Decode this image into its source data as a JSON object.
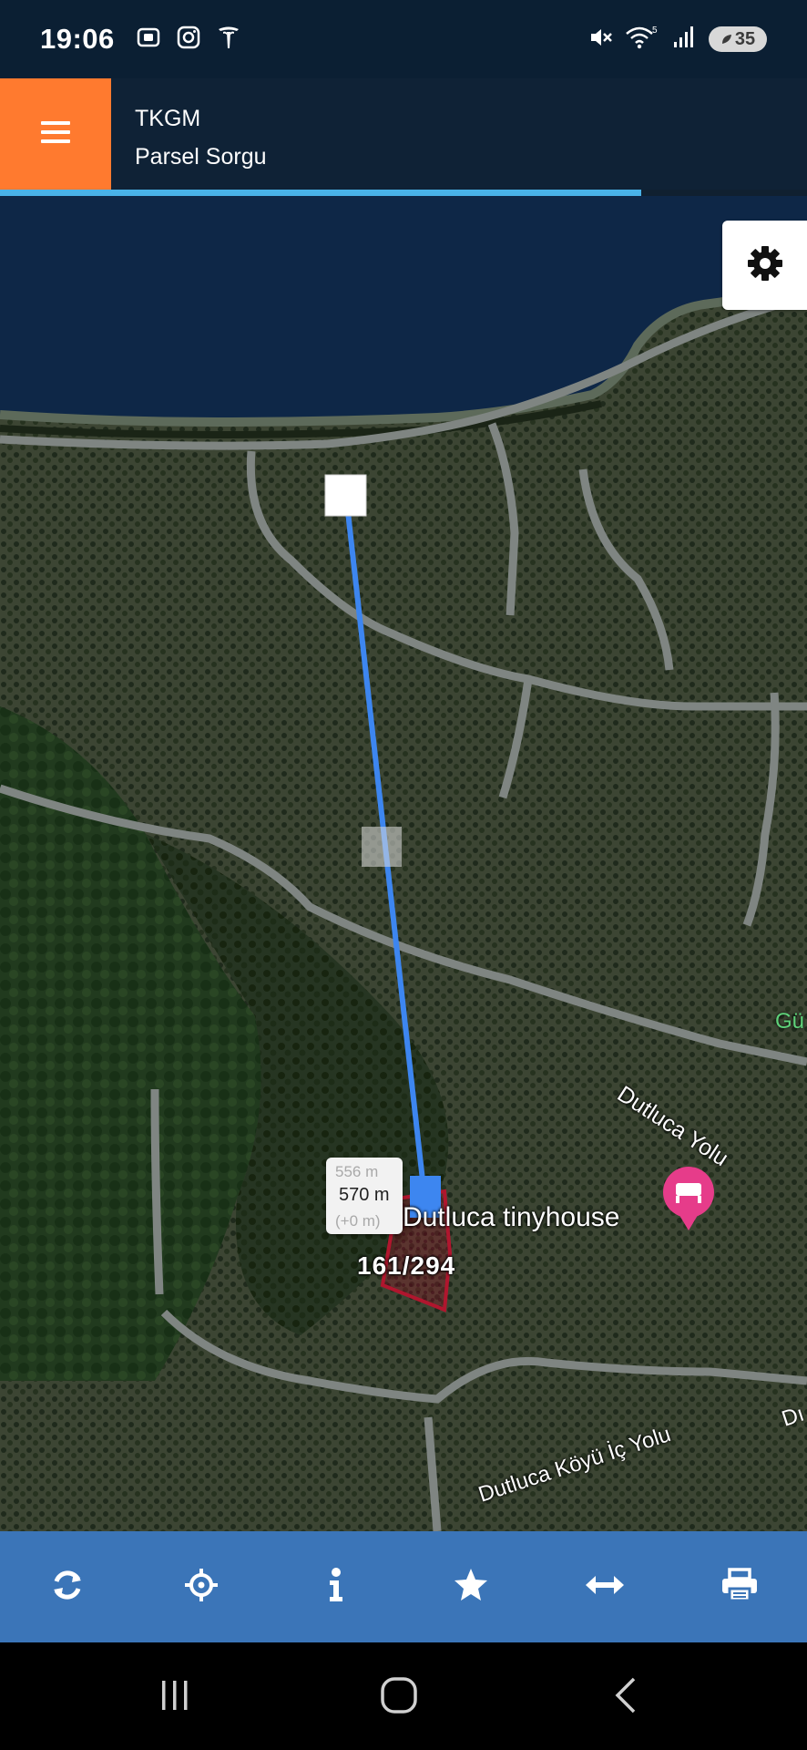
{
  "status_bar": {
    "time": "19:06",
    "battery": "35",
    "left_icons": [
      "screenshot-icon",
      "instagram-icon",
      "tesla-icon"
    ],
    "right_icons": [
      "mute-icon",
      "wifi-icon",
      "signal-icon",
      "battery-icon"
    ]
  },
  "header": {
    "title": "TKGM",
    "subtitle": "Parsel Sorgu",
    "menu_icon": "hamburger-icon",
    "accent_color": "#ff7a2f",
    "bar_color": "#0f2236",
    "progress_color": "#49b2e8"
  },
  "map": {
    "settings_icon": "gear-icon",
    "measure": {
      "ghost_top": "556 m",
      "value": "570 m",
      "ghost_bottom": "(+0 m)",
      "line_color": "#3d86f0"
    },
    "parcel": {
      "label": "161/294",
      "outline_color": "#b0162e"
    },
    "labels": {
      "road_1": "Dutluca Yolu",
      "road_2": "Dutluca Köyü İç Yolu",
      "place": "Dutluca tinyhouse",
      "edge_1": "Gü",
      "edge_2": "Dı"
    },
    "place_icon": "hotel-pin-icon"
  },
  "toolbar": {
    "color": "#3b75b8",
    "buttons": [
      {
        "name": "refresh",
        "icon": "refresh-icon"
      },
      {
        "name": "locate",
        "icon": "crosshair-icon"
      },
      {
        "name": "info",
        "icon": "info-icon"
      },
      {
        "name": "favorite",
        "icon": "star-icon"
      },
      {
        "name": "measure",
        "icon": "arrows-horizontal-icon"
      },
      {
        "name": "print",
        "icon": "printer-icon"
      }
    ]
  },
  "nav_bar": {
    "buttons": [
      "recents-icon",
      "home-icon",
      "back-icon"
    ]
  }
}
